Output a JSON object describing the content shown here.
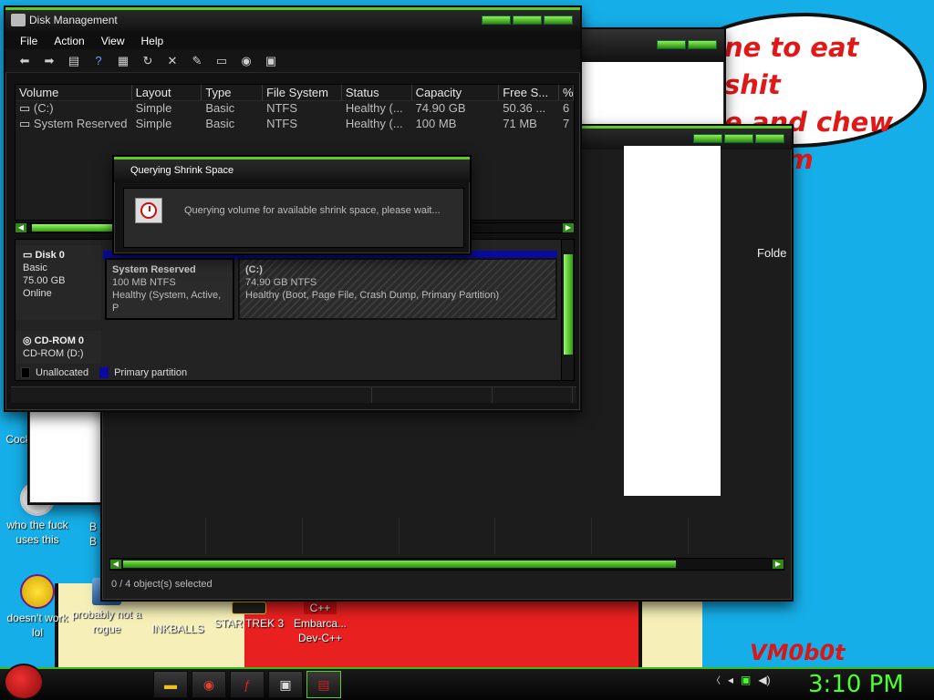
{
  "wallpaper": {
    "bubble_text": "ne to eat shit\ne and chew\ne cum",
    "signature": "VM0b0t"
  },
  "desktop_icons": [
    {
      "label": "Cock",
      "icon": "app-icon"
    },
    {
      "label": "who the fuck uses this",
      "icon": "browser-icon"
    },
    {
      "label": "B B",
      "icon": "app-icon"
    },
    {
      "label": "doesn't work lol",
      "icon": "yahoo-messenger-icon"
    },
    {
      "label": "probably not a rogue",
      "icon": "monitor-icon"
    },
    {
      "label": "INKBALLS",
      "icon": "game-icon"
    },
    {
      "label": "STAR TREK 3",
      "icon": "star-wars-icon"
    },
    {
      "label": "Embarca... Dev-C++",
      "icon": "dev-cpp-icon"
    }
  ],
  "disk_management": {
    "title": "Disk Management",
    "menu": [
      "File",
      "Action",
      "View",
      "Help"
    ],
    "toolbar_icons": [
      "back-icon",
      "forward-icon",
      "console-tree-icon",
      "help-icon",
      "properties-icon",
      "refresh-icon",
      "delete-icon",
      "edit-icon",
      "open-icon",
      "search-icon",
      "rescan-icon"
    ],
    "columns": [
      "Volume",
      "Layout",
      "Type",
      "File System",
      "Status",
      "Capacity",
      "Free S...",
      "%"
    ],
    "rows": [
      [
        "(C:)",
        "Simple",
        "Basic",
        "NTFS",
        "Healthy (...",
        "74.90 GB",
        "50.36 ...",
        "6"
      ],
      [
        "System Reserved",
        "Simple",
        "Basic",
        "NTFS",
        "Healthy (...",
        "100 MB",
        "71 MB",
        "7"
      ]
    ],
    "disks": [
      {
        "name": "Disk 0",
        "type": "Basic",
        "size": "75.00 GB",
        "state": "Online"
      },
      {
        "name": "CD-ROM 0",
        "type": "CD-ROM (D:)",
        "size": "",
        "state": ""
      }
    ],
    "partitions": [
      {
        "name": "System Reserved",
        "size": "100 MB NTFS",
        "status": "Healthy (System, Active, P"
      },
      {
        "name": "(C:)",
        "size": "74.90 GB NTFS",
        "status": "Healthy (Boot, Page File, Crash Dump, Primary Partition)"
      }
    ],
    "legend": {
      "unallocated": "Unallocated",
      "primary": "Primary partition"
    },
    "colors": {
      "unallocated": "#000000",
      "primary": "#0a0aa0"
    }
  },
  "dialog": {
    "title": "Querying Shrink Space",
    "message": "Querying volume for available shrink space, please wait..."
  },
  "explorer": {
    "column": "Folde",
    "status": "0 / 4 object(s) selected"
  },
  "taskbar": {
    "items": [
      "folder-icon",
      "chrome-icon",
      "flash-icon",
      "app-icon",
      "disk-management-icon"
    ],
    "clock": "3:10 PM",
    "accent": "#4cff2e"
  }
}
